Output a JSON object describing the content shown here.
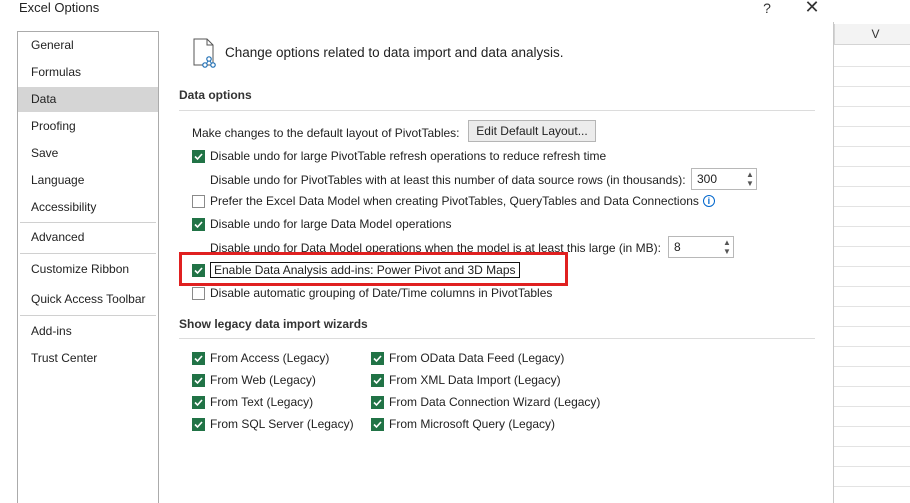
{
  "dialog": {
    "title": "Excel Options",
    "help": "?",
    "close": "✕"
  },
  "sheet": {
    "column": "V"
  },
  "sidebar": {
    "items": [
      {
        "label": "General"
      },
      {
        "label": "Formulas"
      },
      {
        "label": "Data",
        "selected": true
      },
      {
        "label": "Proofing"
      },
      {
        "label": "Save"
      },
      {
        "label": "Language"
      },
      {
        "label": "Accessibility"
      },
      {
        "label": "Advanced"
      },
      {
        "label": "Customize Ribbon"
      },
      {
        "label": "Quick Access Toolbar"
      },
      {
        "label": "Add-ins"
      },
      {
        "label": "Trust Center"
      }
    ]
  },
  "header": {
    "text": "Change options related to data import and data analysis."
  },
  "data_options": {
    "title": "Data options",
    "layout_label": "Make changes to the default layout of PivotTables:",
    "edit_layout_button": "Edit Default Layout...",
    "undo_large_pivot": {
      "label": "Disable undo for large PivotTable refresh operations to reduce refresh time",
      "checked": true
    },
    "undo_rows_label": "Disable undo for PivotTables with at least this number of data source rows (in thousands):",
    "undo_rows_value": "300",
    "prefer_data_model": {
      "label": "Prefer the Excel Data Model when creating PivotTables, QueryTables and Data Connections",
      "checked": false
    },
    "undo_data_model": {
      "label": "Disable undo for large Data Model operations",
      "checked": true
    },
    "undo_model_size_label": "Disable undo for Data Model operations when the model is at least this large (in MB):",
    "undo_model_size_value": "8",
    "enable_addins": {
      "label": "Enable Data Analysis add-ins: Power Pivot and 3D Maps",
      "checked": true
    },
    "disable_grouping": {
      "label": "Disable automatic grouping of Date/Time columns in PivotTables",
      "checked": false
    }
  },
  "legacy": {
    "title": "Show legacy data import wizards",
    "left": [
      {
        "label": "From Access (Legacy)",
        "checked": true
      },
      {
        "label": "From Web (Legacy)",
        "checked": true
      },
      {
        "label": "From Text (Legacy)",
        "checked": true
      },
      {
        "label": "From SQL Server (Legacy)",
        "checked": true
      }
    ],
    "right": [
      {
        "label": "From OData Data Feed (Legacy)",
        "checked": true
      },
      {
        "label": "From XML Data Import (Legacy)",
        "checked": true
      },
      {
        "label": "From Data Connection Wizard (Legacy)",
        "checked": true
      },
      {
        "label": "From Microsoft Query (Legacy)",
        "checked": true
      }
    ]
  },
  "colors": {
    "accent": "#217346",
    "highlight": "#e02020",
    "selected_nav": "#d5d5d5"
  }
}
